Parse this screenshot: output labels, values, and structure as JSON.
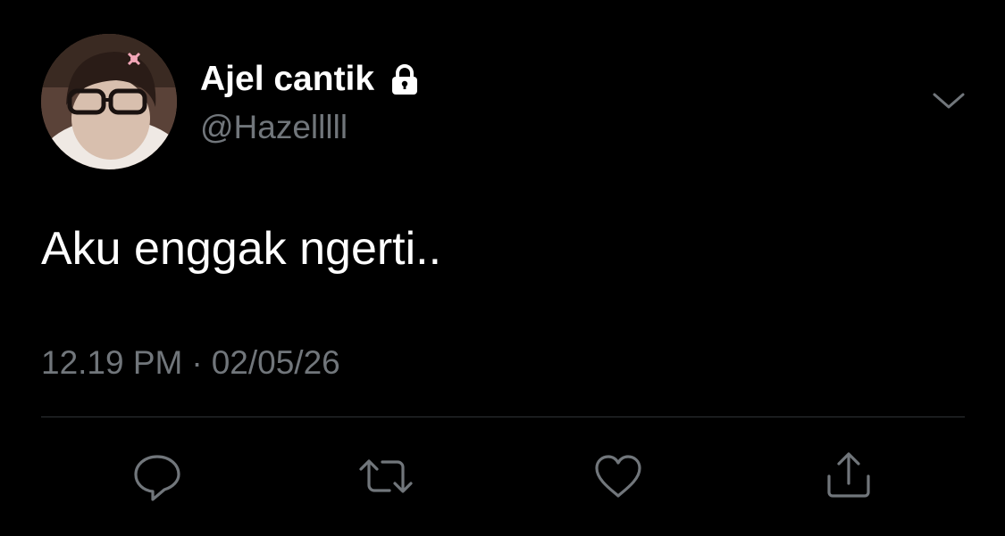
{
  "user": {
    "display_name": "Ajel cantik",
    "handle": "@Hazelllll",
    "protected_icon": "lock-icon",
    "avatar": "avatar-photo"
  },
  "tweet": {
    "text": "Aku enggak ngerti..",
    "time": "12.19 PM",
    "separator": "·",
    "date": "02/05/26"
  },
  "menu": {
    "icon": "chevron-down-icon"
  },
  "actions": [
    {
      "name": "reply",
      "icon": "speech-bubble-icon"
    },
    {
      "name": "retweet",
      "icon": "retweet-arrows-icon"
    },
    {
      "name": "like",
      "icon": "heart-icon"
    },
    {
      "name": "share",
      "icon": "share-upload-icon"
    }
  ],
  "colors": {
    "background": "#000000",
    "text_primary": "#ffffff",
    "text_secondary": "#71767b",
    "divider": "#2f3336"
  }
}
